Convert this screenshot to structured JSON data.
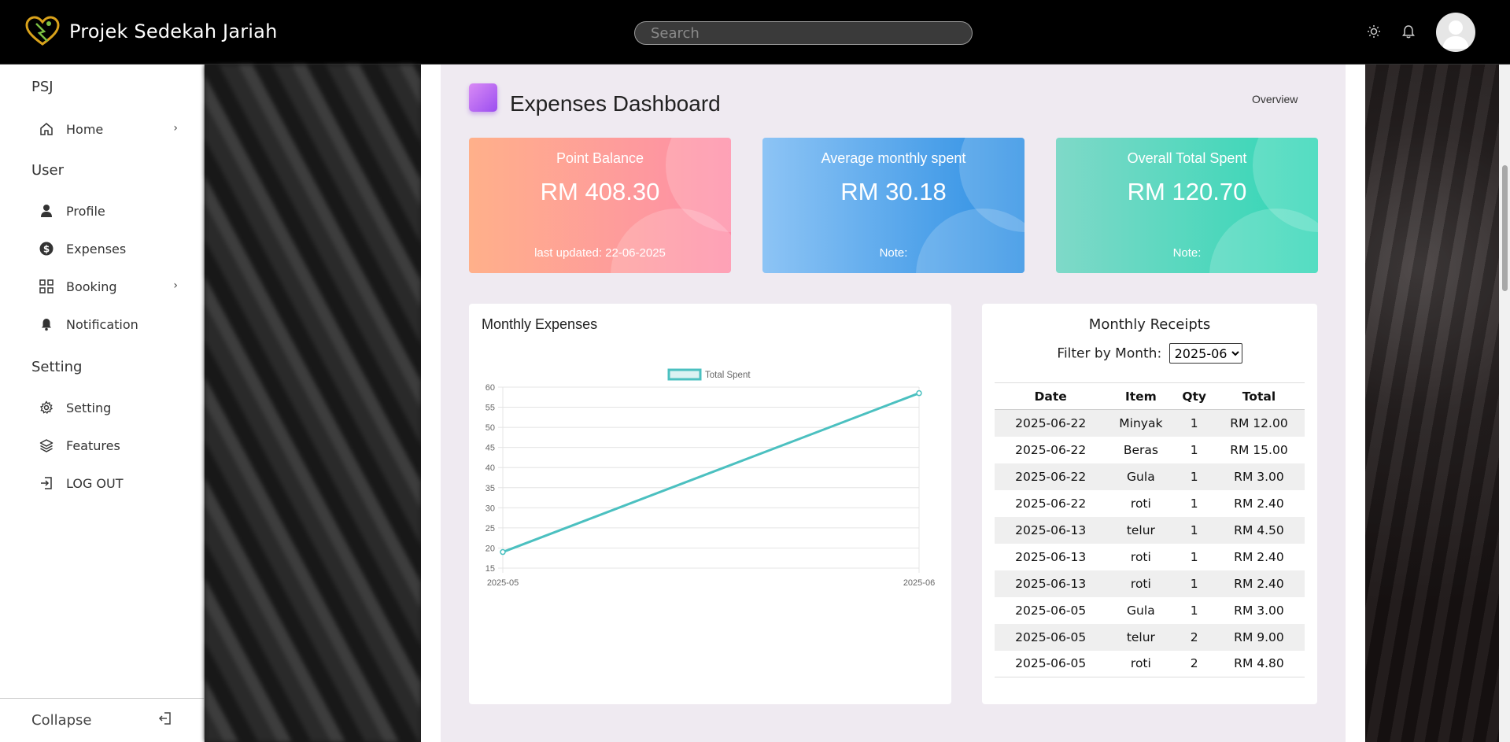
{
  "app": {
    "name": "Projek Sedekah Jariah"
  },
  "search": {
    "placeholder": "Search"
  },
  "icons": {
    "theme": "sun-icon",
    "notifications": "bell-icon",
    "avatar": "user-avatar-icon"
  },
  "sidebar": {
    "sections": [
      {
        "title": "PSJ",
        "items": [
          {
            "label": "Home",
            "icon": "home-icon",
            "has_submenu": true
          }
        ]
      },
      {
        "title": "User",
        "items": [
          {
            "label": "Profile",
            "icon": "user-icon",
            "has_submenu": false
          },
          {
            "label": "Expenses",
            "icon": "dollar-circle-icon",
            "has_submenu": false
          },
          {
            "label": "Booking",
            "icon": "grid-icon",
            "has_submenu": true
          },
          {
            "label": "Notification",
            "icon": "bell-icon",
            "has_submenu": false
          }
        ]
      },
      {
        "title": "Setting",
        "items": [
          {
            "label": "Setting",
            "icon": "gear-icon",
            "has_submenu": false
          },
          {
            "label": "Features",
            "icon": "layers-icon",
            "has_submenu": false
          },
          {
            "label": "LOG OUT",
            "icon": "logout-icon",
            "has_submenu": false
          }
        ]
      }
    ],
    "collapse_label": "Collapse"
  },
  "dashboard": {
    "title": "Expenses Dashboard",
    "overview_label": "Overview",
    "cards": [
      {
        "title": "Point Balance",
        "value": "RM 408.30",
        "note": "last updated: 22-06-2025",
        "colors": [
          "#ffb08a",
          "#fe8da8"
        ]
      },
      {
        "title": "Average monthly spent",
        "value": "RM 30.18",
        "note": "Note:",
        "colors": [
          "#8dc4f5",
          "#2b8ee3"
        ]
      },
      {
        "title": "Overall Total Spent",
        "value": "RM 120.70",
        "note": "Note:",
        "colors": [
          "#7fd9c8",
          "#2fd6b5"
        ]
      }
    ]
  },
  "monthly_expenses": {
    "title": "Monthly Expenses",
    "chart_data": {
      "type": "line",
      "x": [
        "2025-05",
        "2025-06"
      ],
      "series": [
        {
          "name": "Total Spent",
          "values": [
            19,
            58.5
          ],
          "color": "#4bc0c0"
        }
      ],
      "ylim": [
        15,
        60
      ],
      "yticks": [
        15,
        20,
        25,
        30,
        35,
        40,
        45,
        50,
        55,
        60
      ],
      "legend": "top",
      "grid": true
    }
  },
  "receipts": {
    "title": "Monthly Receipts",
    "filter_label": "Filter by Month:",
    "filter_value": "2025-06",
    "columns": [
      "Date",
      "Item",
      "Qty",
      "Total"
    ],
    "rows": [
      [
        "2025-06-22",
        "Minyak",
        "1",
        "RM 12.00"
      ],
      [
        "2025-06-22",
        "Beras",
        "1",
        "RM 15.00"
      ],
      [
        "2025-06-22",
        "Gula",
        "1",
        "RM 3.00"
      ],
      [
        "2025-06-22",
        "roti",
        "1",
        "RM 2.40"
      ],
      [
        "2025-06-13",
        "telur",
        "1",
        "RM 4.50"
      ],
      [
        "2025-06-13",
        "roti",
        "1",
        "RM 2.40"
      ],
      [
        "2025-06-13",
        "roti",
        "1",
        "RM 2.40"
      ],
      [
        "2025-06-05",
        "Gula",
        "1",
        "RM 3.00"
      ],
      [
        "2025-06-05",
        "telur",
        "2",
        "RM 9.00"
      ],
      [
        "2025-06-05",
        "roti",
        "2",
        "RM 4.80"
      ]
    ]
  }
}
